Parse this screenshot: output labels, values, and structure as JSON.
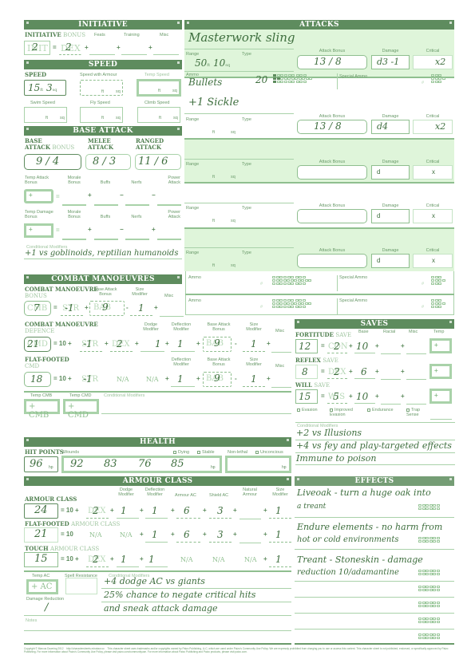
{
  "initiative": {
    "title": "INITIATIVE",
    "label_strong": "INITIATIVE",
    "label_light": "BONUS",
    "cols": [
      "Feats",
      "Training",
      "Misc"
    ],
    "ghost_total": "INIT",
    "total": "2",
    "ghost_dex": "DEX",
    "dex": "2"
  },
  "speed": {
    "title": "SPEED",
    "label": "SPEED",
    "armour_label": "Speed with Armour",
    "temp_label": "Temp Speed",
    "swim_label": "Swim Speed",
    "fly_label": "Fly Speed",
    "climb_label": "Climb Speed",
    "ft": "ft",
    "sq": "sq",
    "base_ft": "15",
    "base_sq": "3"
  },
  "base_attack": {
    "title": "BASE ATTACK",
    "bab_l1": "BASE",
    "bab_l2": "ATTACK",
    "bab_l3": "BONUS",
    "melee_l1": "MELEE",
    "melee_l2": "ATTACK",
    "ranged_l1": "RANGED",
    "ranged_l2": "ATTACK",
    "bab": "9 / 4",
    "melee": "8 / 3",
    "ranged": "11 / 6",
    "temp_attack_cols": [
      "Temp Attack Bonus",
      "Morale Bonus",
      "Buffs",
      "Nerfs",
      "Power Attack"
    ],
    "temp_damage_cols": [
      "Temp Damage Bonus",
      "Morale Bonus",
      "Buffs",
      "Nerfs",
      "Power Attack"
    ],
    "cond_label": "Conditional Modifiers",
    "cond": "+1 vs goblinoids, reptilian humanoids"
  },
  "combat_manoeuvres": {
    "title": "COMBAT MANOEUVRES",
    "cmb_l1": "COMBAT MANOEUVRE",
    "cmb_l2": "BONUS",
    "cmb_cols": [
      "Base Attack Bonus",
      "Size Modifier",
      "Misc"
    ],
    "cmb": "7",
    "cmb_str": "-1",
    "cmb_bab": "9",
    "cmb_size": "1",
    "cmd_l1": "COMBAT MANOEUVRE",
    "cmd_l2": "DEFENCE",
    "cmd_cols": [
      "Dodge Modifier",
      "Deflection Modifier",
      "Base Attack Bonus",
      "Size Modifier",
      "Misc"
    ],
    "cmd": "21",
    "cmd_str": "-1",
    "cmd_dex": "2",
    "cmd_dodge": "1",
    "cmd_defl": "1",
    "cmd_bab": "9",
    "cmd_size": "1",
    "ff_l1": "FLAT-FOOTED",
    "ff_l2": "CMD",
    "ff_cols": [
      "Deflection Modifier",
      "Base Attack Bonus",
      "Size Modifier",
      "Misc"
    ],
    "ff": "18",
    "ff_str": "-1",
    "na": "N/A",
    "ff_defl": "1",
    "ff_bab": "9",
    "ff_size": "1",
    "temp_cmb": "Temp CMB",
    "temp_cmd": "Temp CMD",
    "cond_label": "Conditional Modifiers",
    "plus_cmb": "+ CMB",
    "plus_cmd": "+ CMD"
  },
  "attacks": {
    "title": "ATTACKS",
    "labels": {
      "range": "Range",
      "type": "Type",
      "attack_bonus": "Attack Bonus",
      "damage": "Damage",
      "critical": "Critical",
      "ammo": "Ammo",
      "special_ammo": "Special Ammo",
      "ft": "ft",
      "sq": "sq",
      "hash": "#"
    },
    "weapons": [
      {
        "name": "Masterwork sling",
        "range_ft": "50",
        "range_sq": "10",
        "attack": "13 / 8",
        "damage": "d3 -1",
        "critical": "x2",
        "ammo": "Bullets",
        "ammo_count": "20"
      },
      {
        "name": "+1 Sickle",
        "range_ft": "",
        "range_sq": "",
        "attack": "13 / 8",
        "damage": "d4",
        "critical": "x2"
      },
      {
        "name": "",
        "attack": "",
        "damage": "d",
        "critical": "x"
      },
      {
        "name": "",
        "attack": "",
        "damage": "d",
        "critical": "x"
      },
      {
        "name": "",
        "attack": "",
        "damage": "d",
        "critical": "x"
      }
    ]
  },
  "saves": {
    "title": "SAVES",
    "cols": [
      "Base",
      "Racial",
      "Misc",
      "Temp"
    ],
    "rows": [
      {
        "strong": "FORTITUDE",
        "light": "SAVE",
        "ghost": "CON",
        "total": "12",
        "ability": "2",
        "base": "10"
      },
      {
        "strong": "REFLEX",
        "light": "SAVE",
        "ghost": "DEX",
        "total": "8",
        "ability": "2",
        "base": "6"
      },
      {
        "strong": "WILL",
        "light": "SAVE",
        "ghost": "WIS",
        "total": "15",
        "ability": "5",
        "base": "10"
      }
    ],
    "checks": [
      "Evasion",
      "Improved Evasion",
      "Endurance",
      "Trap Sense"
    ],
    "cond_label": "Conditional Modifiers",
    "cond": [
      "+2 vs Illusions",
      "+4 vs fey and play-targeted effects",
      "Immune to poison"
    ]
  },
  "health": {
    "title": "HEALTH",
    "hp_label": "HIT POINTS",
    "wounds_label": "Wounds",
    "dying": "Dying",
    "stable": "Stable",
    "nonlethal": "Non-lethal",
    "unconscious": "Unconcious",
    "hp": "96",
    "hp_unit": "hp",
    "wounds": [
      "92",
      "83",
      "76",
      "85"
    ]
  },
  "armour": {
    "title": "ARMOUR CLASS",
    "cols": [
      "Dodge Modifier",
      "Deflection Modifier",
      "Armour AC",
      "Shield AC",
      "Natural Armour",
      "Size Modifier"
    ],
    "ac_label": "ARMOUR CLASS",
    "ac": "24",
    "ac_dex": "2",
    "ac_dodge": "1",
    "ac_defl": "1",
    "ac_armour": "6",
    "ac_shield": "3",
    "ac_size": "1",
    "ff_strong": "FLAT-FOOTED",
    "ff_light": "ARMOUR CLASS",
    "ff": "21",
    "ff_defl": "1",
    "ff_armour": "6",
    "ff_shield": "3",
    "ff_size": "1",
    "touch_strong": "TOUCH",
    "touch_light": "ARMOUR CLASS",
    "touch": "15",
    "touch_dex": "2",
    "touch_dodge": "1",
    "touch_defl": "1",
    "touch_size": "1",
    "na": "N/A",
    "temp_ac": "Temp AC",
    "plus_ac": "+ AC",
    "sr_label": "Spell Resistance",
    "dr_label": "Damage Reduction",
    "dr": "/",
    "cond_label": "Conditional Modifiers",
    "cond": [
      "+4 dodge AC vs giants",
      "25% chance to negate critical hits",
      "and sneak attack damage"
    ],
    "notes_label": "Notes"
  },
  "effects": {
    "title": "EFFECTS",
    "items": [
      [
        "Liveoak - turn a huge oak into",
        "a treant"
      ],
      [
        "Endure elements - no harm from",
        "hot or cold environments"
      ],
      [
        "Treant - Stoneskin - damage",
        "reduction 10/adamantine"
      ],
      [
        "",
        ""
      ],
      [
        "",
        ""
      ],
      [
        "",
        ""
      ]
    ]
  },
  "footer": {
    "copyright": "Copyright © Marcus Downing 2012",
    "url": "http://charactersheets.minotaur.cc",
    "legal1": "This character sheet uses trademarks and/or copyrights owned by Paizo Publishing, LLC, which are used under Paizo's Community Use Policy. We are expressly prohibited from charging you to use or access this content.",
    "legal2": "This character sheet is not published, endorsed, or specifically approved by Paizo Publishing. For more information about Paizo's Community Use Policy, please visit paizo.com/communityuse. For more information about Paizo Publishing and Paizo products, please visit paizo.com."
  }
}
